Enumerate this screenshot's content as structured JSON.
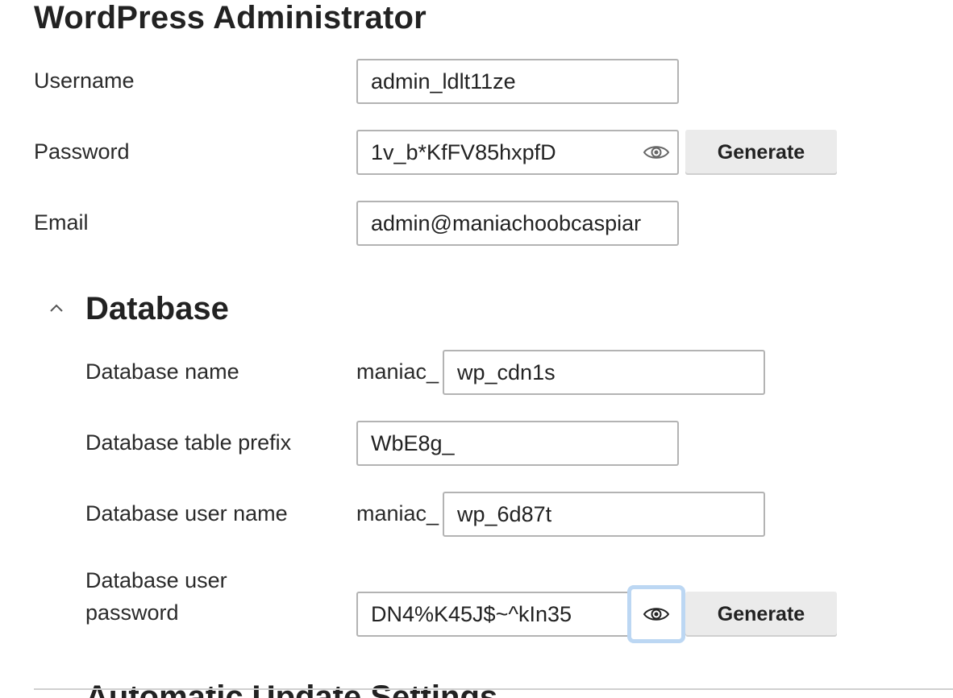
{
  "admin": {
    "title": "WordPress Administrator",
    "username_label": "Username",
    "username_value": "admin_ldlt11ze",
    "password_label": "Password",
    "password_value": "1v_b*KfFV85hxpfD",
    "password_generate": "Generate",
    "email_label": "Email",
    "email_value": "admin@maniachoobcaspiar"
  },
  "database": {
    "title": "Database",
    "expanded": true,
    "db_name_label": "Database name",
    "db_name_prefix": "maniac_",
    "db_name_value": "wp_cdn1s",
    "table_prefix_label": "Database table prefix",
    "table_prefix_value": "WbE8g_",
    "user_name_label": "Database user name",
    "user_name_prefix": "maniac_",
    "user_name_value": "wp_6d87t",
    "user_password_label_line1": "Database user",
    "user_password_label_line2": "password",
    "user_password_value": "DN4%K45J$~^kIn35",
    "user_password_generate": "Generate"
  },
  "next_section": {
    "title": "Automatic Update Settings"
  },
  "icons": {
    "show_password": "eye-icon",
    "collapse": "chevron-up-icon"
  },
  "colors": {
    "focus_ring": "#bcd7f3",
    "input_border": "#b3b3b3",
    "button_bg": "#ebebeb"
  }
}
